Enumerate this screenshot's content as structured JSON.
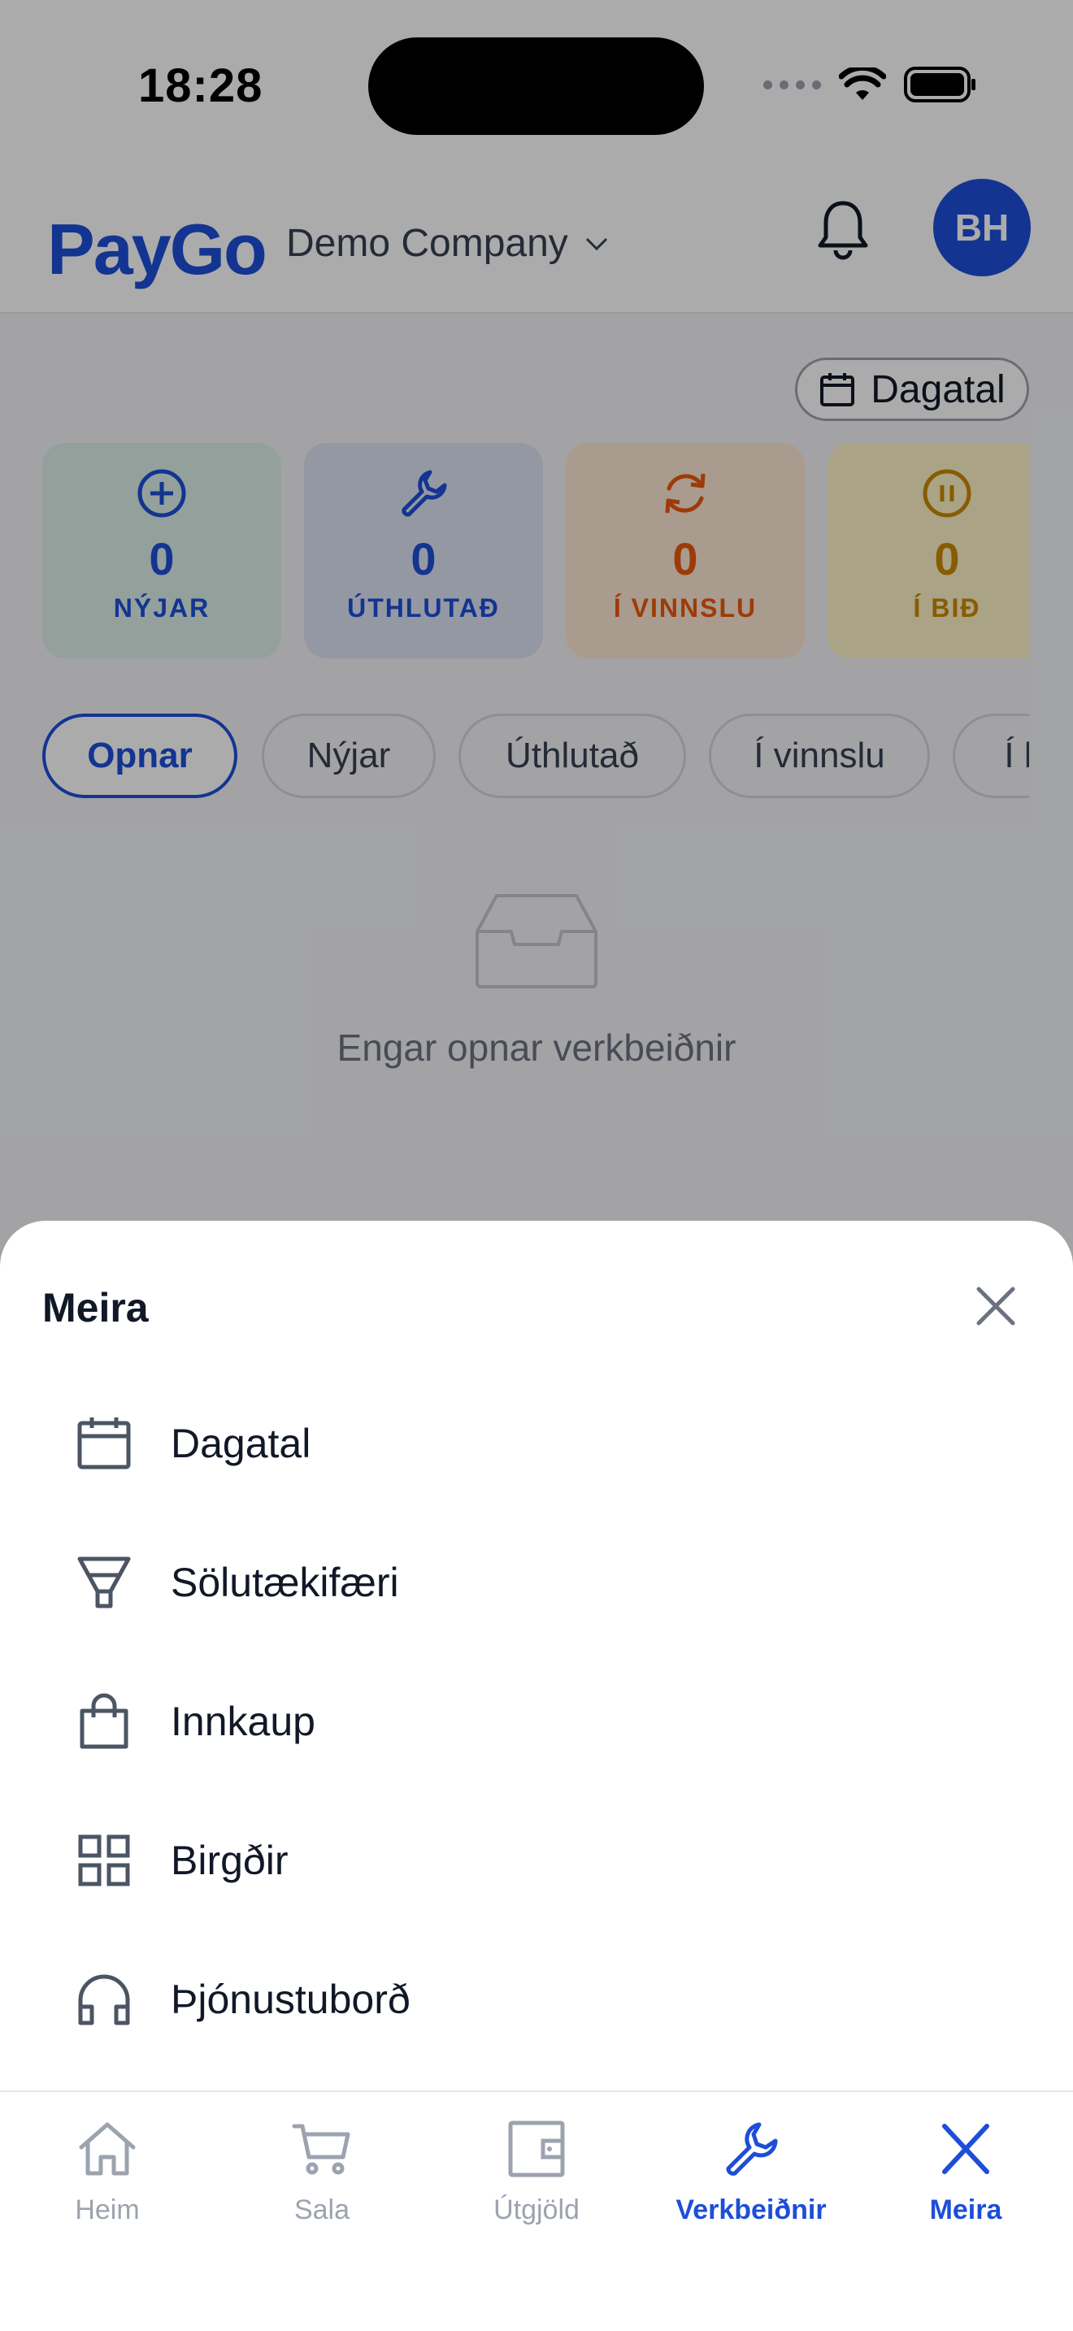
{
  "status_bar": {
    "time": "18:28"
  },
  "header": {
    "logo": "PayGo",
    "company": "Demo Company",
    "avatar_initials": "BH"
  },
  "calendar_button": {
    "label": "Dagatal"
  },
  "status_cards": [
    {
      "count": "0",
      "label": "NÝJAR",
      "color": "#1d4ed8",
      "bg": "#dbeafe",
      "icon": "plus-circle-icon"
    },
    {
      "count": "0",
      "label": "ÚTHLUTAÐ",
      "color": "#1d4ed8",
      "bg": "#dde3f3",
      "icon": "wrench-icon"
    },
    {
      "count": "0",
      "label": "Í VINNSLU",
      "color": "#ea580c",
      "bg": "#fde8d4",
      "icon": "refresh-icon"
    },
    {
      "count": "0",
      "label": "Í BIÐ",
      "color": "#ca8a04",
      "bg": "#fef3c7",
      "icon": "pause-circle-icon"
    }
  ],
  "filter_chips": [
    {
      "label": "Opnar",
      "active": true
    },
    {
      "label": "Nýjar"
    },
    {
      "label": "Úthlutað"
    },
    {
      "label": "Í vinnslu"
    },
    {
      "label": "Í bið"
    }
  ],
  "empty_state": {
    "text": "Engar opnar verkbeiðnir"
  },
  "sheet": {
    "title": "Meira",
    "items": [
      {
        "label": "Dagatal",
        "icon": "calendar-icon"
      },
      {
        "label": "Sölutækifæri",
        "icon": "funnel-icon"
      },
      {
        "label": "Innkaup",
        "icon": "shopping-bag-icon"
      },
      {
        "label": "Birgðir",
        "icon": "grid-icon"
      },
      {
        "label": "Þjónustuborð",
        "icon": "headphones-icon"
      }
    ]
  },
  "tab_bar": {
    "tabs": [
      {
        "label": "Heim",
        "icon": "home-icon"
      },
      {
        "label": "Sala",
        "icon": "cart-icon"
      },
      {
        "label": "Útgjöld",
        "icon": "wallet-icon"
      },
      {
        "label": "Verkbeiðnir",
        "icon": "wrench-icon",
        "active": true
      },
      {
        "label": "Meira",
        "icon": "close-icon",
        "active": true
      }
    ]
  },
  "colors": {
    "brand": "#1d4ed8",
    "muted": "#9ca3af"
  }
}
